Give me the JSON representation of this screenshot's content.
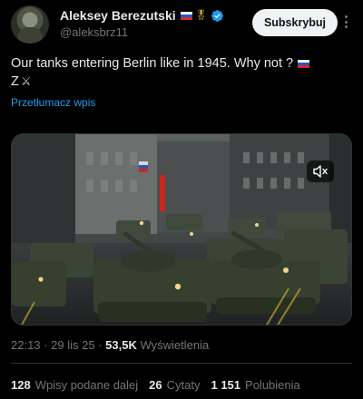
{
  "author": {
    "display_name": "Aleksey Berezutski",
    "handle": "@aleksbrz11",
    "name_emoji": [
      "russian-flag",
      "medal"
    ],
    "verified": true,
    "badge_color": "#1d9bf0"
  },
  "subscribe_label": "Subskrybuj",
  "tweet": {
    "text_line1": "Our tanks entering Berlin like in 1945. Why not ?",
    "text_line2": "Z",
    "text_emoji": [
      "russian-flag",
      "crossed-swords"
    ],
    "translate_label": "Przetłumacz wpis"
  },
  "media": {
    "type": "video",
    "description_icon": "mute-icon"
  },
  "meta": {
    "time": "22:13",
    "date": "29 lis 25",
    "separator": "·",
    "views_count": "53,5K",
    "views_label": "Wyświetlenia"
  },
  "stats": {
    "retweets_count": "128",
    "retweets_label": "Wpisy podane dalej",
    "quotes_count": "26",
    "quotes_label": "Cytaty",
    "likes_count": "1 151",
    "likes_label": "Polubienia"
  },
  "colors": {
    "background": "#000000",
    "text_primary": "#e7e9ea",
    "text_secondary": "#71767b",
    "link": "#1d9bf0",
    "button_bg": "#eff3f4"
  }
}
